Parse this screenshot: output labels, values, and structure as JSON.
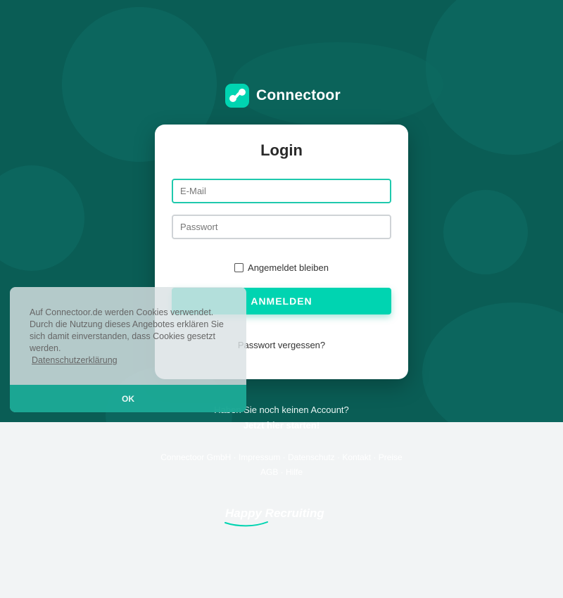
{
  "brand": {
    "name": "Connectoor",
    "logo_icon": "connectoor-logo-icon"
  },
  "login": {
    "title": "Login",
    "email_placeholder": "E-Mail",
    "password_placeholder": "Passwort",
    "remember_label": "Angemeldet bleiben",
    "submit_label": "ANMELDEN",
    "forgot_label": "Passwort vergessen?"
  },
  "signup": {
    "question": "Haben Sie noch keinen Account?",
    "link_label": "Jetzt hier starten!"
  },
  "footer": {
    "line1": "Connectoor GmbH · Impressum · Datenschutz · Kontakt · Preise",
    "line2": "AGB · Hilfe",
    "tagline": "Happy Recruiting"
  },
  "cookie_banner": {
    "text": "Auf Connectoor.de werden Cookies verwendet. Durch die Nutzung dieses Angebotes erklären Sie sich damit einverstanden, dass Cookies gesetzt werden.",
    "link_label": "Datenschutzerklärung",
    "ok_label": "OK"
  },
  "colors": {
    "hero_bg": "#0a5d55",
    "accent": "#00d4b1",
    "page_bg": "#f2f4f5"
  }
}
